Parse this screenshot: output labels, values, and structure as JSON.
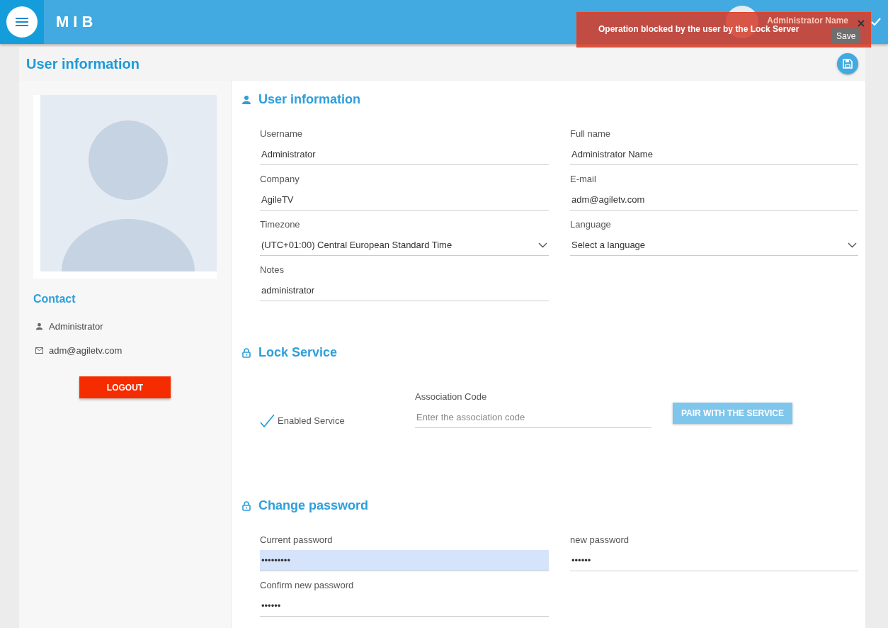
{
  "header": {
    "brand": "MIB",
    "user_name": "Administrator Name"
  },
  "toast": {
    "message": "Operation blocked by the user by the Lock Server"
  },
  "save_tooltip": "Save",
  "page_title": "User information",
  "profile": {
    "contact_heading": "Contact",
    "items": [
      {
        "kind": "user",
        "text": "Administrator"
      },
      {
        "kind": "email",
        "text": "adm@agiletv.com"
      }
    ],
    "logout": "LOGOUT"
  },
  "user_info": {
    "title": "User information",
    "fields": [
      {
        "kind": "text",
        "label": "Username",
        "value": "Administrator"
      },
      {
        "kind": "text",
        "label": "Full name",
        "value": "Administrator Name"
      },
      {
        "kind": "text",
        "label": "Company",
        "value": "AgileTV"
      },
      {
        "kind": "text",
        "label": "E-mail",
        "value": "adm@agiletv.com"
      },
      {
        "kind": "select",
        "label": "Timezone",
        "value": "(UTC+01:00) Central European Standard Time"
      },
      {
        "kind": "select",
        "label": "Language",
        "value": "Select a language"
      },
      {
        "kind": "text",
        "label": "Notes",
        "value": "administrator"
      }
    ]
  },
  "lock_service": {
    "title": "Lock Service",
    "checkbox": {
      "label": "Enabled Service",
      "checked": true
    },
    "association": {
      "label": "Association Code",
      "placeholder": "Enter the association code"
    },
    "button": {
      "label": "PAIR WITH THE SERVICE",
      "disabled": true
    }
  },
  "change_password": {
    "title": "Change password",
    "fields": [
      {
        "kind": "password",
        "label": "Current password",
        "value": "•••••••••",
        "highlighted": true
      },
      {
        "kind": "password",
        "label": "new password",
        "value": "••••••",
        "highlighted": false
      },
      {
        "kind": "password",
        "label": "Confirm new password",
        "value": "••••••",
        "highlighted": false
      }
    ]
  }
}
